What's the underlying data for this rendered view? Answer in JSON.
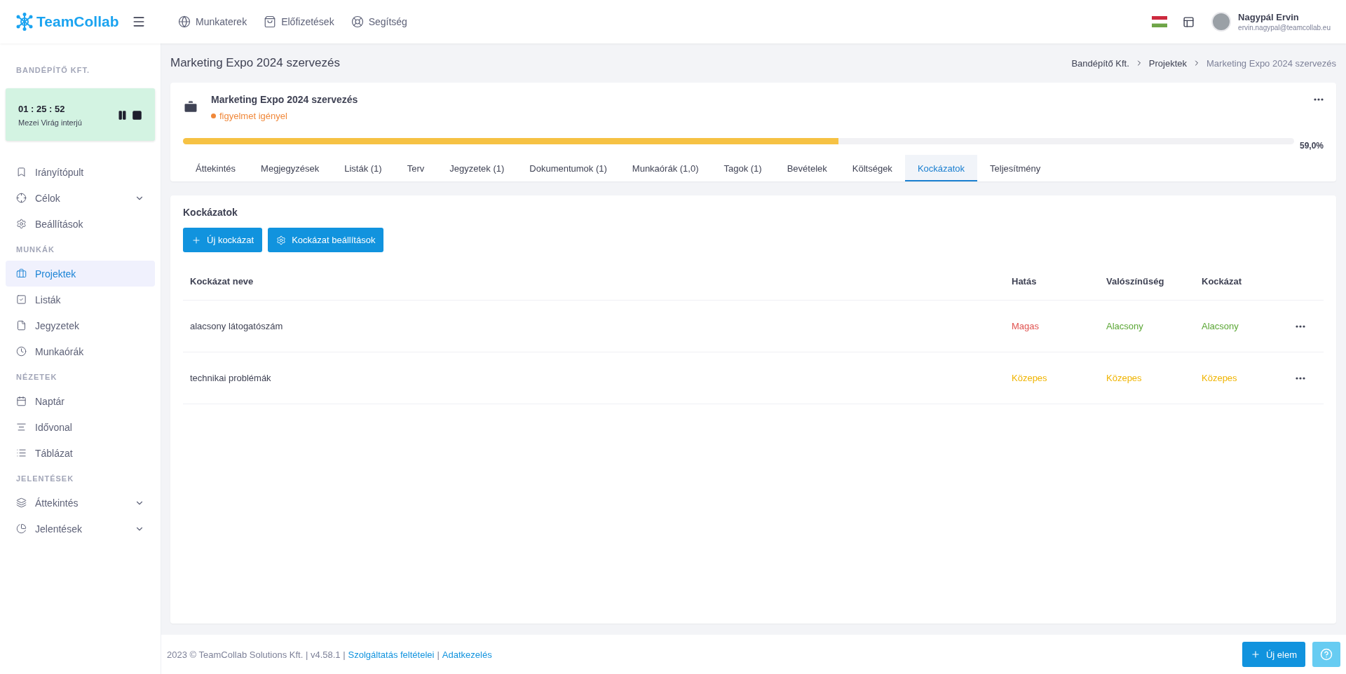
{
  "app": {
    "logo": "TeamCollab"
  },
  "top_nav": [
    {
      "label": "Munkaterek"
    },
    {
      "label": "Előfizetések"
    },
    {
      "label": "Segítség"
    }
  ],
  "user": {
    "name": "Nagypál Ervin",
    "email": "ervin.nagypal@teamcollab.eu"
  },
  "sidebar": {
    "company": "BANDÉPÍTŐ KFT.",
    "timer": {
      "time": "01 : 25 : 52",
      "task": "Mezei Virág interjú"
    },
    "sections": [
      {
        "items": [
          {
            "label": "Irányítópult",
            "selected": false,
            "expandable": false
          },
          {
            "label": "Célok",
            "selected": false,
            "expandable": true
          },
          {
            "label": "Beállítások",
            "selected": false,
            "expandable": false
          }
        ]
      },
      {
        "heading": "MUNKÁK",
        "items": [
          {
            "label": "Projektek",
            "selected": true,
            "expandable": false
          },
          {
            "label": "Listák",
            "selected": false,
            "expandable": false
          },
          {
            "label": "Jegyzetek",
            "selected": false,
            "expandable": false
          },
          {
            "label": "Munkaórák",
            "selected": false,
            "expandable": false
          }
        ]
      },
      {
        "heading": "NÉZETEK",
        "items": [
          {
            "label": "Naptár",
            "selected": false,
            "expandable": false
          },
          {
            "label": "Idővonal",
            "selected": false,
            "expandable": false
          },
          {
            "label": "Táblázat",
            "selected": false,
            "expandable": false
          }
        ]
      },
      {
        "heading": "JELENTÉSEK",
        "items": [
          {
            "label": "Áttekintés",
            "selected": false,
            "expandable": true
          },
          {
            "label": "Jelentések",
            "selected": false,
            "expandable": true
          }
        ]
      }
    ]
  },
  "page": {
    "title": "Marketing Expo 2024 szervezés",
    "breadcrumb": [
      "Bandépítő Kft.",
      "Projektek",
      "Marketing Expo 2024 szervezés"
    ]
  },
  "project": {
    "name": "Marketing Expo 2024 szervezés",
    "status": "figyelmet igényel",
    "level": 0.59,
    "percent": "59,0%",
    "tabs": [
      {
        "label": "Áttekintés",
        "selected": false
      },
      {
        "label": "Megjegyzések",
        "selected": false
      },
      {
        "label": "Listák (1)",
        "selected": false
      },
      {
        "label": "Terv",
        "selected": false
      },
      {
        "label": "Jegyzetek (1)",
        "selected": false
      },
      {
        "label": "Dokumentumok (1)",
        "selected": false
      },
      {
        "label": "Munkaórák (1,0)",
        "selected": false
      },
      {
        "label": "Tagok (1)",
        "selected": false
      },
      {
        "label": "Bevételek",
        "selected": false
      },
      {
        "label": "Költségek",
        "selected": false
      },
      {
        "label": "Kockázatok",
        "selected": true
      },
      {
        "label": "Teljesítmény",
        "selected": false
      }
    ]
  },
  "risks": {
    "title": "Kockázatok",
    "buttons": [
      "Új kockázat",
      "Kockázat beállítások"
    ],
    "columns": [
      "Kockázat neve",
      "Hatás",
      "Valószínűség",
      "Kockázat"
    ],
    "rows": [
      {
        "cells": [
          {
            "text": "alacsony látogatószám"
          },
          {
            "text": "Magas",
            "color": "#e0524f"
          },
          {
            "text": "Alacsony",
            "color": "#5aa634"
          },
          {
            "text": "Alacsony",
            "color": "#5aa634"
          }
        ]
      },
      {
        "cells": [
          {
            "text": "technikai problémák"
          },
          {
            "text": "Közepes",
            "color": "#f0b400"
          },
          {
            "text": "Közepes",
            "color": "#f0b400"
          },
          {
            "text": "Közepes",
            "color": "#f0b400"
          }
        ]
      }
    ]
  },
  "footer": {
    "copyright": "2023 © TeamCollab Solutions Kft. | v4.58.1 |",
    "links": [
      "Szolgáltatás feltételei",
      "Adatkezelés"
    ],
    "separator": "|",
    "new_button": "Új elem"
  }
}
